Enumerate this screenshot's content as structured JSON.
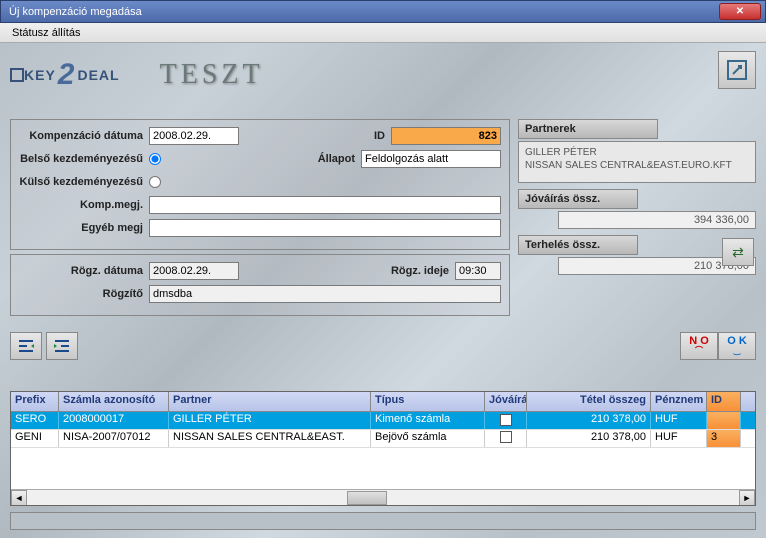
{
  "window": {
    "title": "Új kompenzáció megadása"
  },
  "menu": {
    "status": "Státusz állítás"
  },
  "logo": {
    "key": "KEY",
    "deal": "DEAL",
    "teszt": "TESZT"
  },
  "form": {
    "date_label": "Kompenzáció dátuma",
    "date_value": "2008.02.29.",
    "id_label": "ID",
    "id_value": "823",
    "internal_label": "Belső kezdeményezésű",
    "external_label": "Külső kezdeményezésű",
    "status_label": "Állapot",
    "status_value": "Feldolgozás alatt",
    "comp_note_label": "Komp.megj.",
    "comp_note_value": "",
    "other_note_label": "Egyéb megj",
    "other_note_value": "",
    "rec_date_label": "Rögz. dátuma",
    "rec_date_value": "2008.02.29.",
    "rec_time_label": "Rögz. ideje",
    "rec_time_value": "09:30",
    "recorder_label": "Rögzítő",
    "recorder_value": "dmsdba"
  },
  "partners": {
    "header": "Partnerek",
    "items": [
      "GILLER PÉTER",
      "NISSAN SALES CENTRAL&EAST.EURO.KFT"
    ]
  },
  "credit_sum": {
    "label": "Jóváírás össz.",
    "value": "394 336,00"
  },
  "debit_sum": {
    "label": "Terhelés össz.",
    "value": "210 378,00"
  },
  "grid": {
    "headers": {
      "prefix": "Prefix",
      "invoice": "Számla azonosító",
      "partner": "Partner",
      "type": "Típus",
      "credit": "Jóváírá",
      "amount": "Tétel összeg",
      "currency": "Pénznem",
      "id": "ID"
    },
    "rows": [
      {
        "prefix": "SERO",
        "invoice": "2008000017",
        "partner": "GILLER PÉTER",
        "type": "Kimenő számla",
        "credit": true,
        "amount": "210 378,00",
        "currency": "HUF",
        "id": ""
      },
      {
        "prefix": "GENI",
        "invoice": "NISA-2007/07012",
        "partner": "NISSAN SALES CENTRAL&EAST.",
        "type": "Bejövő számla",
        "credit": false,
        "amount": "210 378,00",
        "currency": "HUF",
        "id": "3"
      }
    ]
  },
  "buttons": {
    "no": "N O",
    "ok": "O K"
  }
}
